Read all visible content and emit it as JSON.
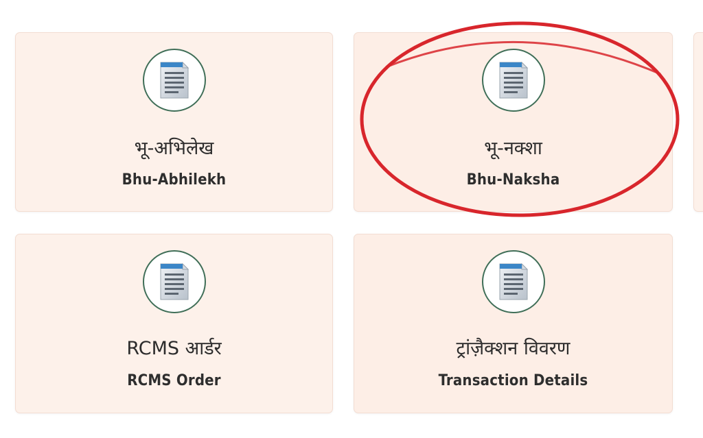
{
  "cards": [
    {
      "title_hi": "भू-अभिलेख",
      "title_en": "Bhu-Abhilekh",
      "icon": "document-icon"
    },
    {
      "title_hi": "भू-नक्शा",
      "title_en": "Bhu-Naksha",
      "icon": "document-icon"
    },
    {
      "title_hi": "RCMS आर्डर",
      "title_en": "RCMS Order",
      "icon": "document-icon"
    },
    {
      "title_hi": "ट्रांज़ैक्शन विवरण",
      "title_en": "Transaction Details",
      "icon": "document-icon"
    }
  ],
  "colors": {
    "card_bg": "#fdf1ea",
    "icon_ring": "#3f6e57",
    "highlight_ring": "#d8262c"
  }
}
